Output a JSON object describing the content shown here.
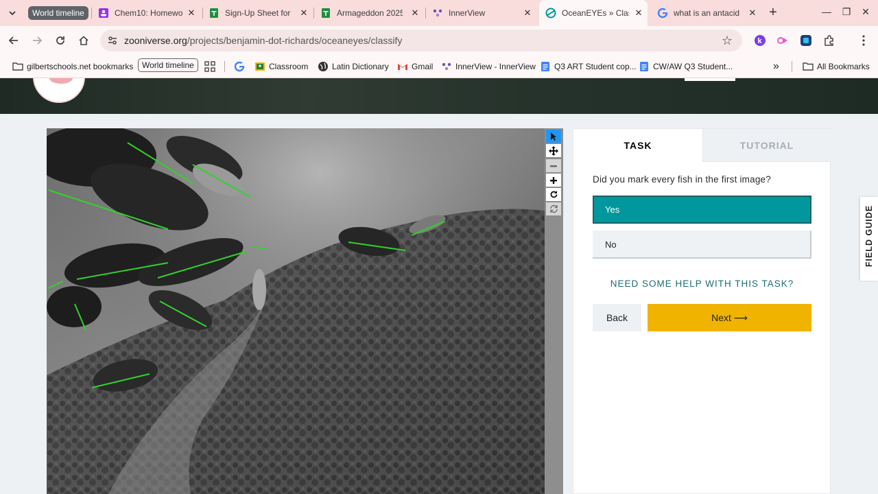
{
  "browser": {
    "tab_group_label": "World timeline",
    "tabs": [
      {
        "title": "Chem10: Homewo",
        "icon": "assignment-icon",
        "color": "#9334e6"
      },
      {
        "title": "Sign-Up Sheet for C",
        "icon": "sheets-icon",
        "color": "#1e8e3e"
      },
      {
        "title": "Armageddon 2025",
        "icon": "sheets-icon",
        "color": "#1e8e3e"
      },
      {
        "title": "InnerView",
        "icon": "innerview-icon",
        "color": "#6a4fb3"
      },
      {
        "title": "OceanEYEs » Class",
        "icon": "zooniverse-icon",
        "color": "#00979d",
        "active": true
      },
      {
        "title": "what is an antacid",
        "icon": "google-icon",
        "color": "#4285f4"
      }
    ],
    "url_host": "zooniverse.org",
    "url_path": "/projects/benjamin-dot-richards/oceaneyes/classify",
    "bookmarks": {
      "apps_label": "gilbertschools.net bookmarks",
      "group_chip": "World timeline",
      "items": [
        {
          "label": "Classroom",
          "icon": "classroom-icon"
        },
        {
          "label": "Latin Dictionary",
          "icon": "globe-icon"
        },
        {
          "label": "Gmail",
          "icon": "gmail-icon"
        },
        {
          "label": "InnerView - InnerView",
          "icon": "innerview-icon"
        },
        {
          "label": "Q3 ART Student cop...",
          "icon": "docs-icon"
        },
        {
          "label": "CW/AW Q3 Student...",
          "icon": "docs-icon"
        }
      ],
      "all_bookmarks": "All Bookmarks"
    }
  },
  "task": {
    "tab_task": "TASK",
    "tab_tutorial": "TUTORIAL",
    "question": "Did you mark every fish in the first image?",
    "answers": [
      {
        "label": "Yes",
        "selected": true
      },
      {
        "label": "No",
        "selected": false
      }
    ],
    "help_link": "NEED SOME HELP WITH THIS TASK?",
    "back_label": "Back",
    "next_label": "Next ⟶"
  },
  "field_guide_label": "FIELD GUIDE",
  "colors": {
    "accent_teal": "#00979d",
    "next_yellow": "#f0b400",
    "mark_lines": "#32d22c",
    "tab_strip": "#f9dcdc"
  }
}
